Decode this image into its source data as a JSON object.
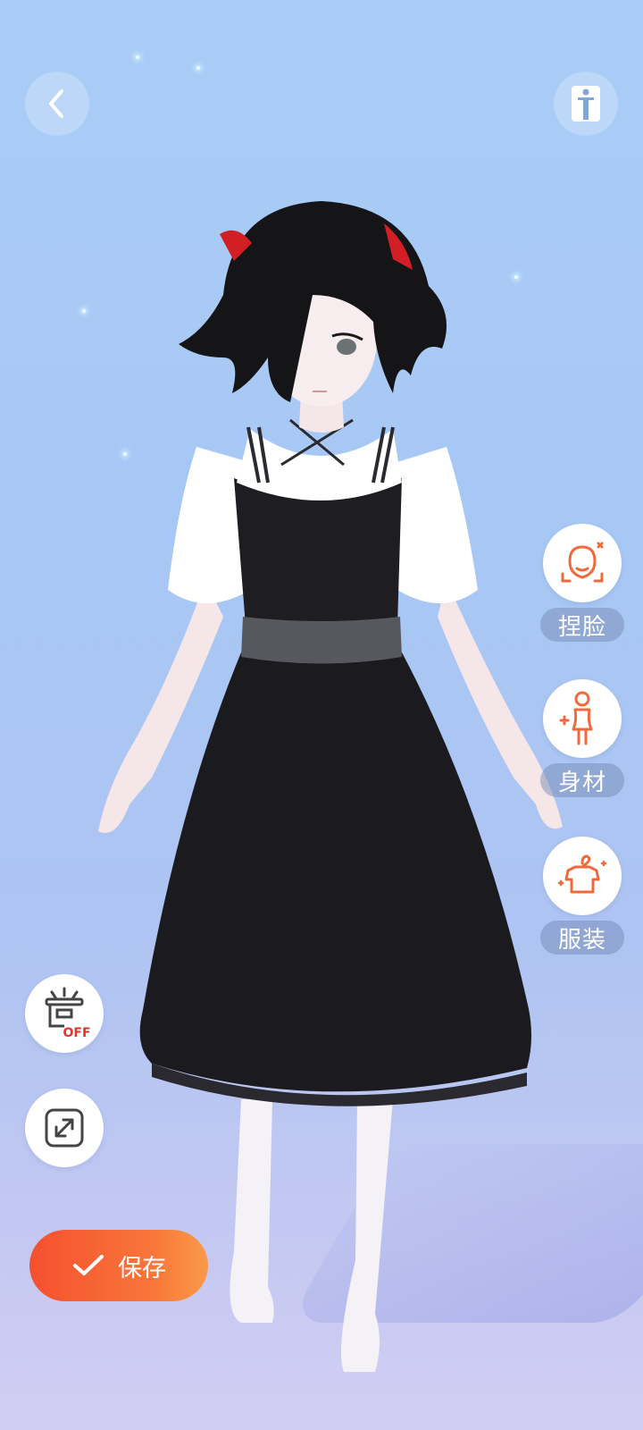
{
  "nav": {
    "back_icon": "chevron-left-icon",
    "pose_icon": "standing-person-icon"
  },
  "side_menu": [
    {
      "label": "捏脸",
      "icon": "face-shape-icon"
    },
    {
      "label": "身材",
      "icon": "body-figure-icon"
    },
    {
      "label": "服装",
      "icon": "clothes-hanger-icon"
    }
  ],
  "tools": {
    "platform_toggle": {
      "icon": "stage-light-icon",
      "state": "OFF"
    },
    "fullscreen_icon": "expand-arrows-icon"
  },
  "save_button": {
    "label": "保存",
    "icon": "checkmark-icon"
  },
  "colors": {
    "accent": "#f5502f",
    "accent_end": "#fb9a48",
    "icon_orange": "#f26a3b",
    "toggle_off": "#e5352a"
  }
}
